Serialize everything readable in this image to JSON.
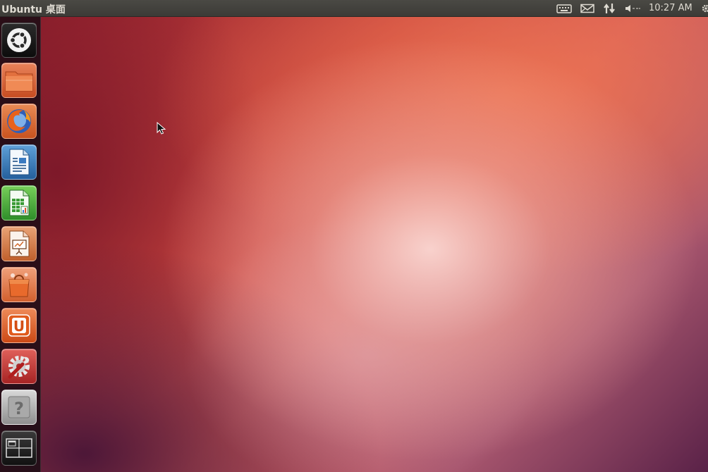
{
  "panel": {
    "title": "Ubuntu 桌面",
    "clock": "10:27 AM",
    "indicators": [
      "keyboard-icon",
      "mail-icon",
      "network-icon",
      "volume-icon",
      "gear-icon"
    ]
  },
  "launcher": {
    "items": [
      {
        "name": "dash-home",
        "icon": "ubuntu-logo-icon"
      },
      {
        "name": "home-folder",
        "icon": "folder-icon"
      },
      {
        "name": "firefox",
        "icon": "firefox-icon"
      },
      {
        "name": "libreoffice-writer",
        "icon": "writer-icon"
      },
      {
        "name": "libreoffice-calc",
        "icon": "calc-icon"
      },
      {
        "name": "libreoffice-impress",
        "icon": "impress-icon"
      },
      {
        "name": "software-center",
        "icon": "software-center-icon"
      },
      {
        "name": "ubuntu-one",
        "icon": "ubuntu-one-icon"
      },
      {
        "name": "system-settings",
        "icon": "settings-icon"
      },
      {
        "name": "help",
        "icon": "help-icon"
      },
      {
        "name": "workspace-switcher",
        "icon": "workspace-switcher-icon"
      }
    ],
    "help_glyph": "?",
    "ubuntu_one_glyph": "U"
  },
  "colors": {
    "panel": "#3c3b37",
    "panel_text": "#dfdbd2",
    "orange": "#dd4814",
    "wallpaper_base": "#c8443e"
  }
}
